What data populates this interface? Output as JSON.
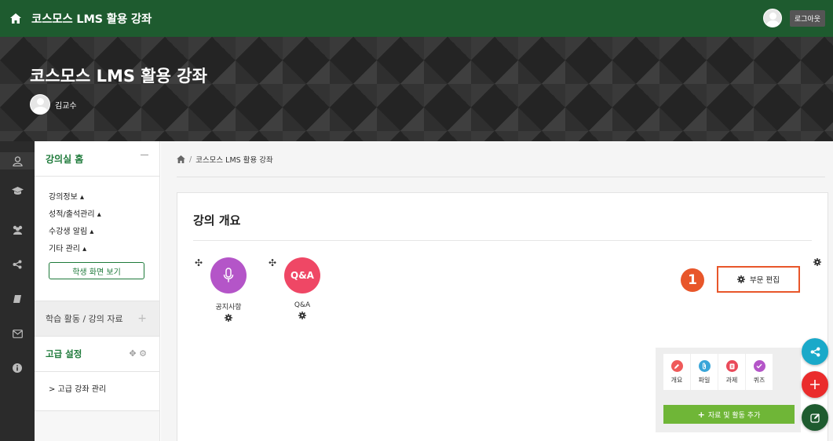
{
  "topbar": {
    "site_title": "코스모스 LMS 활용 강좌",
    "logout": "로그아웃",
    "color": "#1e5b2f"
  },
  "banner": {
    "course_title": "코스모스 LMS 활용 강좌",
    "teacher": "김교수"
  },
  "rail": {
    "icons": [
      "user-icon",
      "graduation-cap-icon",
      "group-icon",
      "share-icon",
      "book-icon",
      "mail-icon",
      "info-icon"
    ]
  },
  "leftmenu": {
    "home": "강의실 홈",
    "items": [
      "강의정보 ▴",
      "성적/출석관리 ▴",
      "수강생 알림 ▴",
      "기타 관리 ▴"
    ],
    "student_view": "학생 화면 보기",
    "activities": "학습 활동 / 강의 자료",
    "advanced": "고급 설정",
    "advanced_item": "> 고급 강좌 관리"
  },
  "breadcrumb": {
    "sep": "/",
    "current": "코스모스 LMS 활용 강좌"
  },
  "section": {
    "title": "강의 개요",
    "activities": [
      {
        "label": "공지사항",
        "icon": "microphone-icon",
        "color": "#b455c8"
      },
      {
        "label": "Q&A",
        "icon_text": "Q&A",
        "color": "#ef4765"
      }
    ],
    "badge": "1",
    "edit_label": "부문 편집"
  },
  "quick_add": {
    "items": [
      {
        "label": "개요",
        "color": "#ef5a5a",
        "icon": "pencil-icon"
      },
      {
        "label": "파일",
        "color": "#3aa6d9",
        "icon": "file-icon"
      },
      {
        "label": "과제",
        "color": "#ea4a5a",
        "icon": "assignment-icon"
      },
      {
        "label": "퀴즈",
        "color": "#b455c8",
        "icon": "check-icon"
      }
    ],
    "add_label": "자료 및 활동 추가",
    "add_color": "#6fb637"
  },
  "fabs": {
    "share_color": "#1aa9c9",
    "plus_color": "#ea2c2c",
    "edit_color": "#1e5b2f"
  }
}
